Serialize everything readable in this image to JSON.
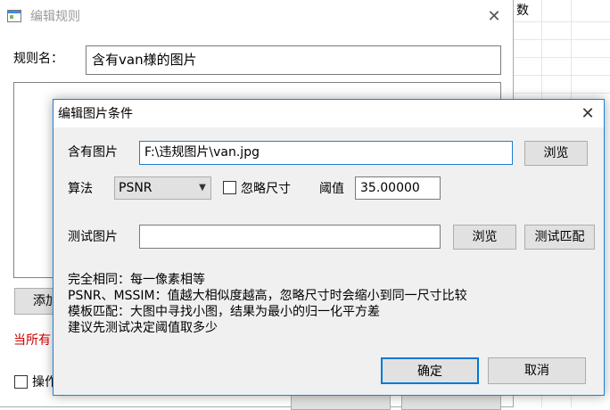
{
  "background_app": {
    "column_header": "数"
  },
  "rule_dialog": {
    "title": "编辑规则",
    "close_icon": "close-icon",
    "name_label": "规则名：",
    "name_value": "含有van様的图片",
    "add_button_label": "添加",
    "warning_text": "当所有",
    "operation_checkbox_label": "操作"
  },
  "image_dialog": {
    "title": "编辑图片条件",
    "close_icon": "close-icon",
    "contain_image_label": "含有图片",
    "contain_image_value": "F:\\违规图片\\van.jpg",
    "browse_label": "浏览",
    "algorithm_label": "算法",
    "algorithm_value": "PSNR",
    "ignore_size_label": "忽略尺寸",
    "ignore_size_checked": false,
    "threshold_label": "阈值",
    "threshold_value": "35.00000",
    "test_image_label": "测试图片",
    "test_image_value": "",
    "test_browse_label": "浏览",
    "test_match_label": "测试匹配",
    "help_lines": [
      "完全相同：每一像素相等",
      "PSNR、MSSIM：值越大相似度越高，忽略尺寸时会缩小到同一尺寸比较",
      "模板匹配：大图中寻找小图，结果为最小的归一化平方差",
      "建议先测试决定阈值取多少"
    ],
    "ok_label": "确定",
    "cancel_label": "取消"
  },
  "colors": {
    "accent": "#0078d7",
    "warning": "#d00000",
    "button_face": "#e1e1e1",
    "dialog_face": "#f0f0f0"
  }
}
